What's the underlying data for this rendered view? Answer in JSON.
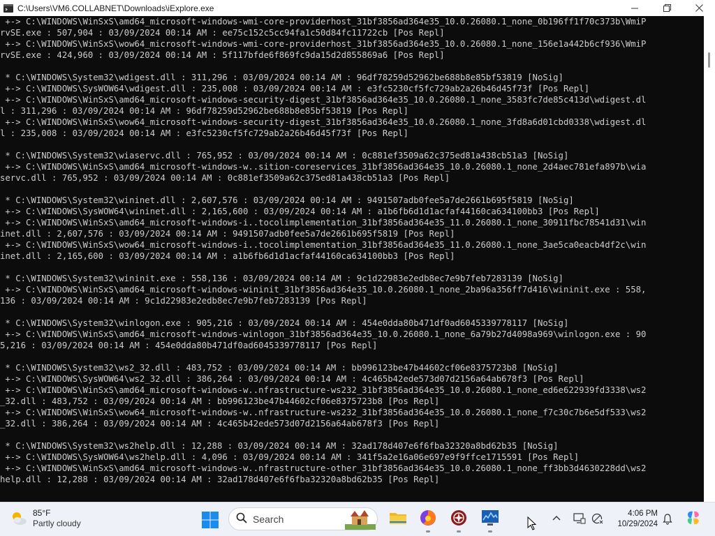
{
  "window": {
    "title": "C:\\Users\\VM6.COLLABNET\\Downloads\\iExplore.exe",
    "minimize_icon": "minimize-icon",
    "maximize_icon": "restore-icon",
    "close_icon": "close-icon"
  },
  "console": {
    "lines": [
      " +-> C:\\WINDOWS\\WinSxS\\amd64_microsoft-windows-wmi-core-providerhost_31bf3856ad364e35_10.0.26080.1_none_0b196ff1f70c373b\\WmiP",
      "rvSE.exe : 507,904 : 03/09/2024 00:14 AM : ee75c152c5cc94fa1c50d84fc11722cb [Pos Repl]",
      " +-> C:\\WINDOWS\\WinSxS\\wow64_microsoft-windows-wmi-core-providerhost_31bf3856ad364e35_10.0.26080.1_none_156e1a442b6cf936\\WmiP",
      "rvSE.exe : 424,960 : 03/09/2024 00:14 AM : 5f117bfde6f869fc9da15d2d855869a6 [Pos Repl]",
      "",
      " * C:\\WINDOWS\\System32\\wdigest.dll : 311,296 : 03/09/2024 00:14 AM : 96df78259d52962be688b8e85bf53819 [NoSig]",
      " +-> C:\\WINDOWS\\SysWOW64\\wdigest.dll : 235,008 : 03/09/2024 00:14 AM : e3fc5230cf5fc729ab2a26b46d45f73f [Pos Repl]",
      " +-> C:\\WINDOWS\\WinSxS\\amd64_microsoft-windows-security-digest_31bf3856ad364e35_10.0.26080.1_none_3583fc7de85c413d\\wdigest.dl",
      "l : 311,296 : 03/09/2024 00:14 AM : 96df78259d52962be688b8e85bf53819 [Pos Repl]",
      " +-> C:\\WINDOWS\\WinSxS\\wow64_microsoft-windows-security-digest_31bf3856ad364e35_10.0.26080.1_none_3fd8a6d01cbd0338\\wdigest.dl",
      "l : 235,008 : 03/09/2024 00:14 AM : e3fc5230cf5fc729ab2a26b46d45f73f [Pos Repl]",
      "",
      " * C:\\WINDOWS\\System32\\wiaservc.dll : 765,952 : 03/09/2024 00:14 AM : 0c881ef3509a62c375ed81a438cb51a3 [NoSig]",
      " +-> C:\\WINDOWS\\WinSxS\\amd64_microsoft-windows-w..sition-coreservices_31bf3856ad364e35_10.0.26080.1_none_2d4aec781efa897b\\wia",
      "servc.dll : 765,952 : 03/09/2024 00:14 AM : 0c881ef3509a62c375ed81a438cb51a3 [Pos Repl]",
      "",
      " * C:\\WINDOWS\\System32\\wininet.dll : 2,607,576 : 03/09/2024 00:14 AM : 9491507adb0fee5a7de2661b695f5819 [NoSig]",
      " +-> C:\\WINDOWS\\SysWOW64\\wininet.dll : 2,165,600 : 03/09/2024 00:14 AM : a1b6fb6d1d1acfaf44160ca634100bb3 [Pos Repl]",
      " +-> C:\\WINDOWS\\WinSxS\\amd64_microsoft-windows-i..tocolimplementation_31bf3856ad364e35_11.0.26080.1_none_30911fbc78541d31\\win",
      "inet.dll : 2,607,576 : 03/09/2024 00:14 AM : 9491507adb0fee5a7de2661b695f5819 [Pos Repl]",
      " +-> C:\\WINDOWS\\WinSxS\\wow64_microsoft-windows-i..tocolimplementation_31bf3856ad364e35_11.0.26080.1_none_3ae5ca0eacb4df2c\\win",
      "inet.dll : 2,165,600 : 03/09/2024 00:14 AM : a1b6fb6d1d1acfaf44160ca634100bb3 [Pos Repl]",
      "",
      " * C:\\WINDOWS\\System32\\wininit.exe : 558,136 : 03/09/2024 00:14 AM : 9c1d22983e2edb8ec7e9b7feb7283139 [NoSig]",
      " +-> C:\\WINDOWS\\WinSxS\\amd64_microsoft-windows-wininit_31bf3856ad364e35_10.0.26080.1_none_2ba96a356ff7d416\\wininit.exe : 558,",
      "136 : 03/09/2024 00:14 AM : 9c1d22983e2edb8ec7e9b7feb7283139 [Pos Repl]",
      "",
      " * C:\\WINDOWS\\System32\\winlogon.exe : 905,216 : 03/09/2024 00:14 AM : 454e0dda80b471df0ad6045339778117 [NoSig]",
      " +-> C:\\WINDOWS\\WinSxS\\amd64_microsoft-windows-winlogon_31bf3856ad364e35_10.0.26080.1_none_6a79b27d4098a969\\winlogon.exe : 90",
      "5,216 : 03/09/2024 00:14 AM : 454e0dda80b471df0ad6045339778117 [Pos Repl]",
      "",
      " * C:\\WINDOWS\\System32\\ws2_32.dll : 483,752 : 03/09/2024 00:14 AM : bb996123be47b44602cf06e8375723b8 [NoSig]",
      " +-> C:\\WINDOWS\\SysWOW64\\ws2_32.dll : 386,264 : 03/09/2024 00:14 AM : 4c465b42ede573d07d2156a64ab678f3 [Pos Repl]",
      " +-> C:\\WINDOWS\\WinSxS\\amd64_microsoft-windows-w..nfrastructure-ws232_31bf3856ad364e35_10.0.26080.1_none_ed6e622939fd3338\\ws2",
      "_32.dll : 483,752 : 03/09/2024 00:14 AM : bb996123be47b44602cf06e8375723b8 [Pos Repl]",
      " +-> C:\\WINDOWS\\WinSxS\\wow64_microsoft-windows-w..nfrastructure-ws232_31bf3856ad364e35_10.0.26080.1_none_f7c30c7b6e5df533\\ws2",
      "_32.dll : 386,264 : 03/09/2024 00:14 AM : 4c465b42ede573d07d2156a64ab678f3 [Pos Repl]",
      "",
      " * C:\\WINDOWS\\System32\\ws2help.dll : 12,288 : 03/09/2024 00:14 AM : 32ad178d407e6f6fba32320a8bd62b35 [NoSig]",
      " +-> C:\\WINDOWS\\SysWOW64\\ws2help.dll : 4,096 : 03/09/2024 00:14 AM : 341f5a2e16a06e697e9f9ffce1715591 [Pos Repl]",
      " +-> C:\\WINDOWS\\WinSxS\\amd64_microsoft-windows-w..nfrastructure-other_31bf3856ad364e35_10.0.26080.1_none_ff3bb3d4630228dd\\ws2",
      "help.dll : 12,288 : 03/09/2024 00:14 AM : 32ad178d407e6f6fba32320a8bd62b35 [Pos Repl]"
    ]
  },
  "taskbar": {
    "weather": {
      "temp": "85°F",
      "desc": "Partly cloudy",
      "icon": "partly-cloudy-icon"
    },
    "search": {
      "label": "Search"
    },
    "apps": [
      {
        "name": "file-explorer-icon",
        "active": false
      },
      {
        "name": "firefox-icon",
        "active": true
      },
      {
        "name": "iexplore-app-icon",
        "active": true
      },
      {
        "name": "performance-monitor-icon",
        "active": true
      }
    ],
    "clock": {
      "time": "4:06 PM",
      "date": "10/29/2024"
    },
    "colors": {
      "taskbar_bg": "#eef1f7",
      "console_bg": "#0c0c0c",
      "console_text": "#cccccc"
    }
  }
}
